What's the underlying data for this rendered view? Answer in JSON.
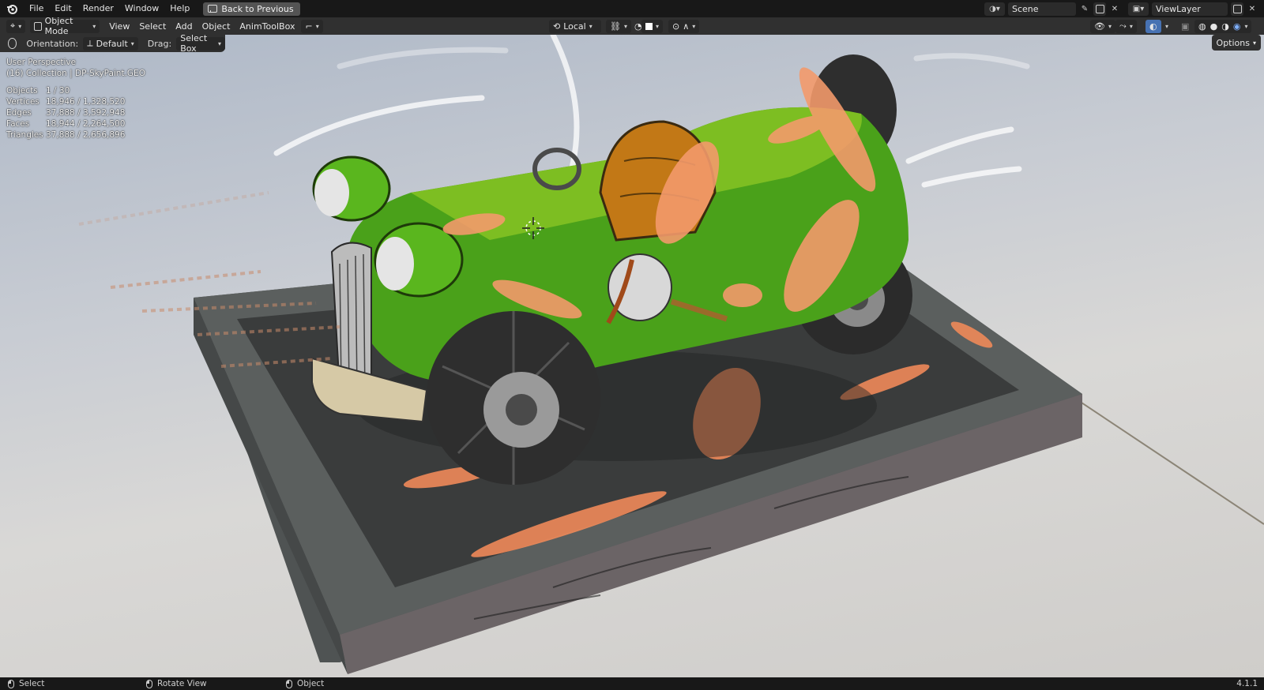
{
  "topbar": {
    "menu": [
      "File",
      "Edit",
      "Render",
      "Window",
      "Help"
    ],
    "back_button": "Back to Previous",
    "scene": "Scene",
    "view_layer": "ViewLayer"
  },
  "header": {
    "mode": "Object Mode",
    "menus": [
      "View",
      "Select",
      "Add",
      "Object",
      "AnimToolBox"
    ],
    "pivot": "Local"
  },
  "toolrow": {
    "orientation_label": "Orientation:",
    "orientation_value": "Default",
    "drag_label": "Drag:",
    "drag_value": "Select Box",
    "options": "Options"
  },
  "overlay": {
    "perspective": "User Perspective",
    "collection": "(16) Collection | DP-SkyPaint.GEO",
    "stats": [
      {
        "key": "Objects",
        "value": "1 / 30"
      },
      {
        "key": "Vertices",
        "value": "18,946 / 1,328,520"
      },
      {
        "key": "Edges",
        "value": "37,888 / 3,592,948"
      },
      {
        "key": "Faces",
        "value": "18,944 / 2,264,500"
      },
      {
        "key": "Triangles",
        "value": "37,888 / 2,656,896"
      }
    ]
  },
  "statusbar": {
    "select": "Select",
    "rotate": "Rotate View",
    "object": "Object",
    "version": "4.1.1"
  },
  "icons": [
    "blender-logo-icon",
    "editor-type-icon",
    "object-mode-icon",
    "pivot-icon",
    "snap-icon",
    "proportional-icon",
    "gizmo-icon",
    "overlay-icon",
    "xray-icon",
    "wireframe-shading-icon",
    "solid-shading-icon",
    "material-shading-icon",
    "rendered-shading-icon"
  ]
}
